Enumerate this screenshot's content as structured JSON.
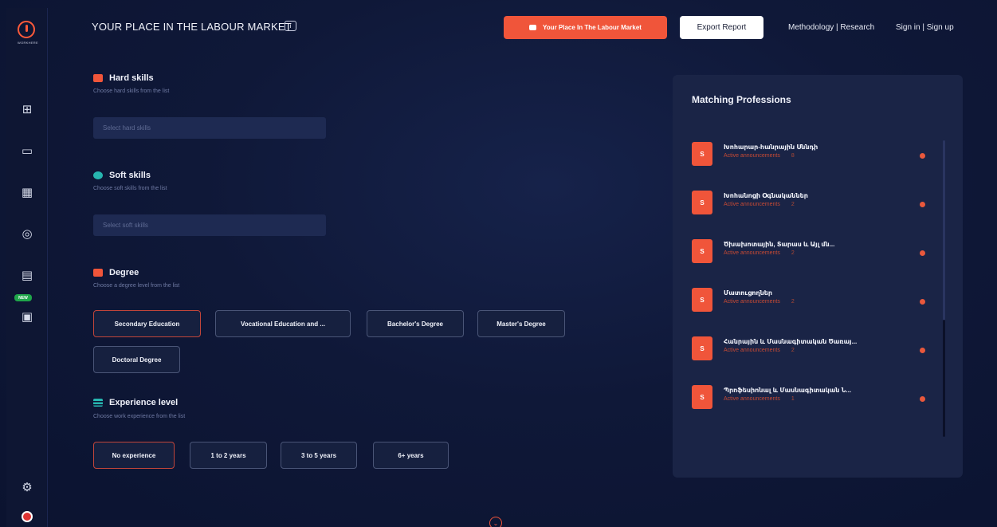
{
  "app": {
    "logo_text": "WORKHERE"
  },
  "header": {
    "title": "YOUR PLACE IN THE LABOUR MARKET",
    "info_icon": "i",
    "place_button_label": "Your Place In The Labour Market",
    "export_button_label": "Export Report",
    "methodology_link": "Methodology | Research",
    "auth_link": "Sign in | Sign up"
  },
  "sidebar": {
    "items": [
      {
        "icon": "dashboard-icon",
        "glyph": "⊞"
      },
      {
        "icon": "briefcase-icon",
        "glyph": "▭"
      },
      {
        "icon": "table-icon",
        "glyph": "▦"
      },
      {
        "icon": "target-icon",
        "glyph": "◎"
      },
      {
        "icon": "list-icon",
        "glyph": "▤"
      },
      {
        "icon": "calendar-icon",
        "glyph": "▣"
      }
    ],
    "new_badge": "NEW",
    "bottom_icon": "settings-icon",
    "bottom_glyph": "⚙"
  },
  "hard_skills": {
    "title": "Hard skills",
    "subtitle": "Choose hard skills from the list",
    "placeholder": "Select hard skills"
  },
  "soft_skills": {
    "title": "Soft skills",
    "subtitle": "Choose soft skills from the list",
    "placeholder": "Select soft skills"
  },
  "degree": {
    "title": "Degree",
    "subtitle": "Choose a degree level from the list",
    "options": [
      "Secondary Education",
      "Vocational Education and ...",
      "Bachelor's Degree",
      "Master's Degree",
      "Doctoral Degree"
    ],
    "selected": "Secondary Education"
  },
  "experience": {
    "title": "Experience level",
    "subtitle": "Choose work experience from the list",
    "options": [
      "No experience",
      "1 to 2 years",
      "3 to 5 years",
      "6+ years"
    ],
    "selected": "No experience"
  },
  "matching": {
    "title": "Matching Professions",
    "active_label": "Active announcements",
    "items": [
      {
        "avatar": "S",
        "name": "Խոհարար-հանրային Սննդի",
        "count": "8"
      },
      {
        "avatar": "S",
        "name": "Խոհանոցի Օգնականներ",
        "count": "2"
      },
      {
        "avatar": "S",
        "name": "Ծխախոտային, Տարաս և Այլ մն...",
        "count": "2"
      },
      {
        "avatar": "S",
        "name": "Մատուցողներ",
        "count": "2"
      },
      {
        "avatar": "S",
        "name": "Հանրային և Մասնագիտական Ծառայ...",
        "count": "2"
      },
      {
        "avatar": "S",
        "name": "Պրոֆեսիոնալ և Մասնագիտական Ն...",
        "count": "1"
      }
    ]
  },
  "colors": {
    "accent": "#f0553a",
    "background": "#0f1838",
    "panel": "#1a2446",
    "new_badge": "#1fa64a"
  }
}
